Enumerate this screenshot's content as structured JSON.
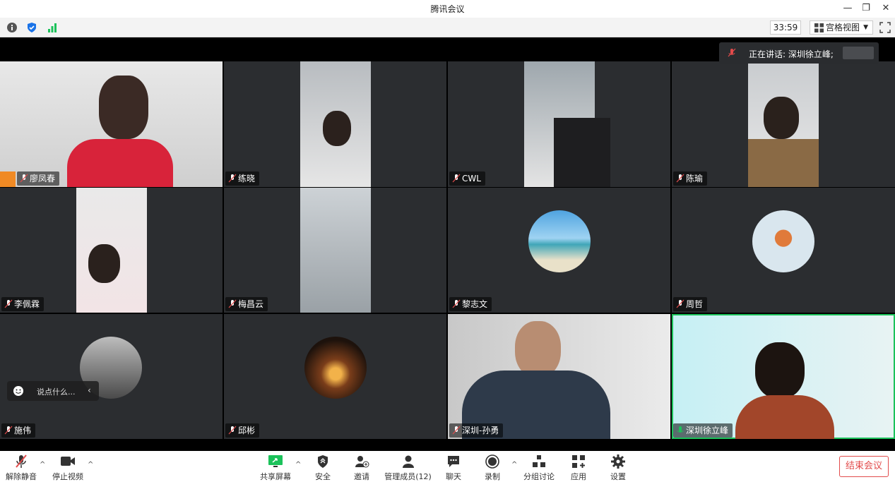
{
  "window": {
    "title": "腾讯会议"
  },
  "toolbar": {
    "timer": "33:59",
    "view_label": "宫格视图"
  },
  "speaking": {
    "label": "正在讲话: 深圳徐立峰;"
  },
  "tiles": [
    {
      "name": "廖凤春"
    },
    {
      "name": "练晓"
    },
    {
      "name": "CWL"
    },
    {
      "name": "陈瑜"
    },
    {
      "name": "李佩霖"
    },
    {
      "name": "梅昌云"
    },
    {
      "name": "黎志文"
    },
    {
      "name": "周哲"
    },
    {
      "name": "施伟"
    },
    {
      "name": "邱彬"
    },
    {
      "name": "深圳-孙勇"
    },
    {
      "name": "深圳徐立峰"
    }
  ],
  "chat": {
    "placeholder": "说点什么..."
  },
  "controls": {
    "unmute": "解除静音",
    "stop_video": "停止视频",
    "share": "共享屏幕",
    "security": "安全",
    "invite": "邀请",
    "members": "管理成员(12)",
    "chat": "聊天",
    "record": "录制",
    "breakout": "分组讨论",
    "apps": "应用",
    "settings": "设置",
    "end": "结束会议"
  },
  "colors": {
    "active_border": "#1bc25a",
    "end_red": "#e24b4b",
    "tile_bg": "#2b2d30"
  }
}
